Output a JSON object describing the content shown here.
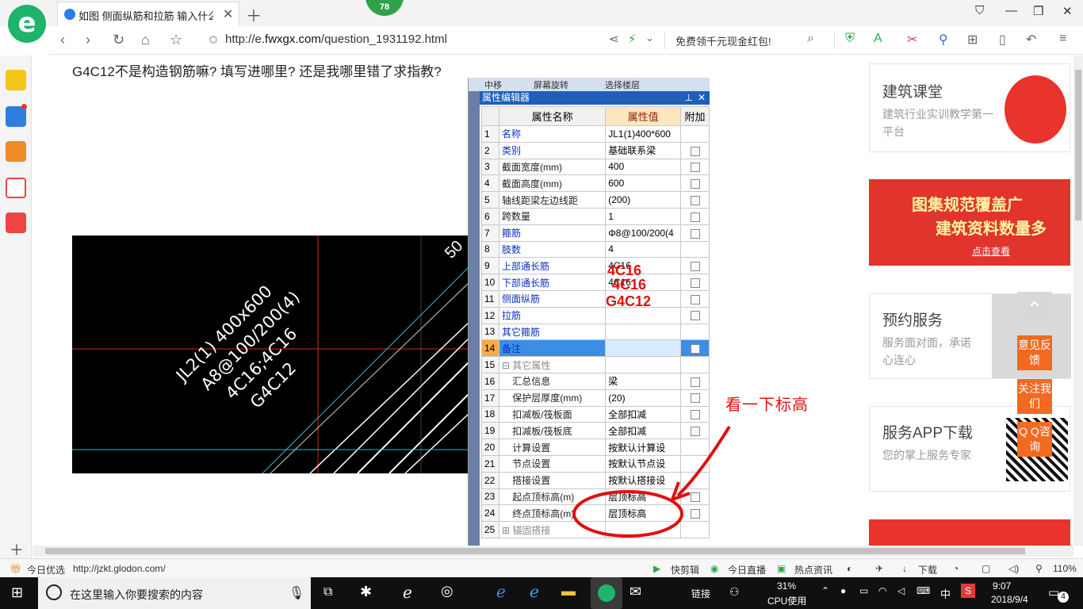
{
  "browser": {
    "tab_title": "如图 侧面纵筋和拉筋 输入什么?",
    "badge": "78",
    "url_prefix": "http://e.",
    "url_host": "fwxgx.com",
    "url_path": "/question_1931192.html",
    "promo": "免费领千元现金红包!"
  },
  "page": {
    "question": "G4C12不是构造钢筋嘛? 填写进哪里? 还是我哪里错了求指教?"
  },
  "cad": {
    "label_lines": [
      "JL2(1) 400x600",
      "A8@100/200(4)",
      "4C16;4C16",
      "G4C12"
    ],
    "corner_text": "50"
  },
  "prop_editor": {
    "toolbar_items": [
      "中移",
      "屏幕旋转",
      "选择楼层"
    ],
    "title": "属性编辑器",
    "col_name": "属性名称",
    "col_value": "属性值",
    "col_extra": "附加",
    "rows": [
      {
        "n": "1",
        "name": "名称",
        "value": "JL1(1)400*600",
        "style": "blue",
        "chk": false
      },
      {
        "n": "2",
        "name": "类别",
        "value": "基础联系梁",
        "style": "blue",
        "chk": true
      },
      {
        "n": "3",
        "name": "截面宽度(mm)",
        "value": "400",
        "style": "black",
        "chk": true
      },
      {
        "n": "4",
        "name": "截面高度(mm)",
        "value": "600",
        "style": "black",
        "chk": true
      },
      {
        "n": "5",
        "name": "轴线距梁左边线距",
        "value": "(200)",
        "style": "black",
        "chk": true
      },
      {
        "n": "6",
        "name": "跨数量",
        "value": "1",
        "style": "black",
        "chk": true
      },
      {
        "n": "7",
        "name": "箍筋",
        "value": "Φ8@100/200(4",
        "style": "blue",
        "chk": true
      },
      {
        "n": "8",
        "name": "肢数",
        "value": "4",
        "style": "blue",
        "chk": false
      },
      {
        "n": "9",
        "name": "上部通长筋",
        "value": "4C16",
        "style": "blue",
        "chk": true
      },
      {
        "n": "10",
        "name": "下部通长筋",
        "value": "4C16",
        "style": "blue",
        "chk": true
      },
      {
        "n": "11",
        "name": "侧面纵筋",
        "value": "",
        "style": "blue",
        "chk": true
      },
      {
        "n": "12",
        "name": "拉筋",
        "value": "",
        "style": "blue",
        "chk": true
      },
      {
        "n": "13",
        "name": "其它箍筋",
        "value": "",
        "style": "blue",
        "chk": false
      },
      {
        "n": "14",
        "name": "备注",
        "value": "",
        "style": "sel",
        "chk": true
      },
      {
        "n": "15",
        "name": "⊟ 其它属性",
        "value": "",
        "style": "gray",
        "chk": false
      },
      {
        "n": "16",
        "name": "    汇总信息",
        "value": "梁",
        "style": "black",
        "chk": true
      },
      {
        "n": "17",
        "name": "    保护层厚度(mm)",
        "value": "(20)",
        "style": "black",
        "chk": true
      },
      {
        "n": "18",
        "name": "    扣减板/筏板面",
        "value": "全部扣减",
        "style": "black",
        "chk": true
      },
      {
        "n": "19",
        "name": "    扣减板/筏板底",
        "value": "全部扣减",
        "style": "black",
        "chk": true
      },
      {
        "n": "20",
        "name": "    计算设置",
        "value": "按默认计算设",
        "style": "black",
        "chk": false
      },
      {
        "n": "21",
        "name": "    节点设置",
        "value": "按默认节点设",
        "style": "black",
        "chk": false
      },
      {
        "n": "22",
        "name": "    搭接设置",
        "value": "按默认搭接设",
        "style": "black",
        "chk": false
      },
      {
        "n": "23",
        "name": "    起点顶标高(m)",
        "value": "层顶标高",
        "style": "black",
        "chk": true
      },
      {
        "n": "24",
        "name": "    终点顶标高(m)",
        "value": "层顶标高",
        "style": "black",
        "chk": true
      },
      {
        "n": "25",
        "name": "⊞ 锚固搭接",
        "value": "",
        "style": "gray",
        "chk": false
      }
    ]
  },
  "handwritten": {
    "line1": "4C16",
    "line2": "4C16",
    "line3": "G4C12"
  },
  "annotation": {
    "note": "看一下标高"
  },
  "ads": {
    "card1_title": "建筑课堂",
    "card1_sub": "建筑行业实训教学第一平台",
    "banner1_line1": "图集规范覆盖广",
    "banner1_line2": "建筑资料数量多",
    "banner1_btn": "点击查看",
    "card2_title": "预约服务",
    "card2_sub": "服务面对面，承诺心连心",
    "card3_title": "服务APP下载",
    "card3_sub": "您的掌上服务专家"
  },
  "float_buttons": {
    "feedback": "意见反馈",
    "follow": "关注我们",
    "qq": "Q Q咨询"
  },
  "statusbar": {
    "left_label": "今日优选",
    "link": "http://jzkt.glodon.com/",
    "items": [
      "快剪辑",
      "今日直播",
      "热点资讯",
      "下载"
    ],
    "zoom": "110%"
  },
  "taskbar": {
    "search_placeholder": "在这里输入你要搜索的内容",
    "link_label": "链接",
    "cpu_pct": "31%",
    "cpu_label": "CPU使用",
    "ime": "中",
    "time": "9:07",
    "date": "2018/9/4",
    "notif_count": "4"
  }
}
